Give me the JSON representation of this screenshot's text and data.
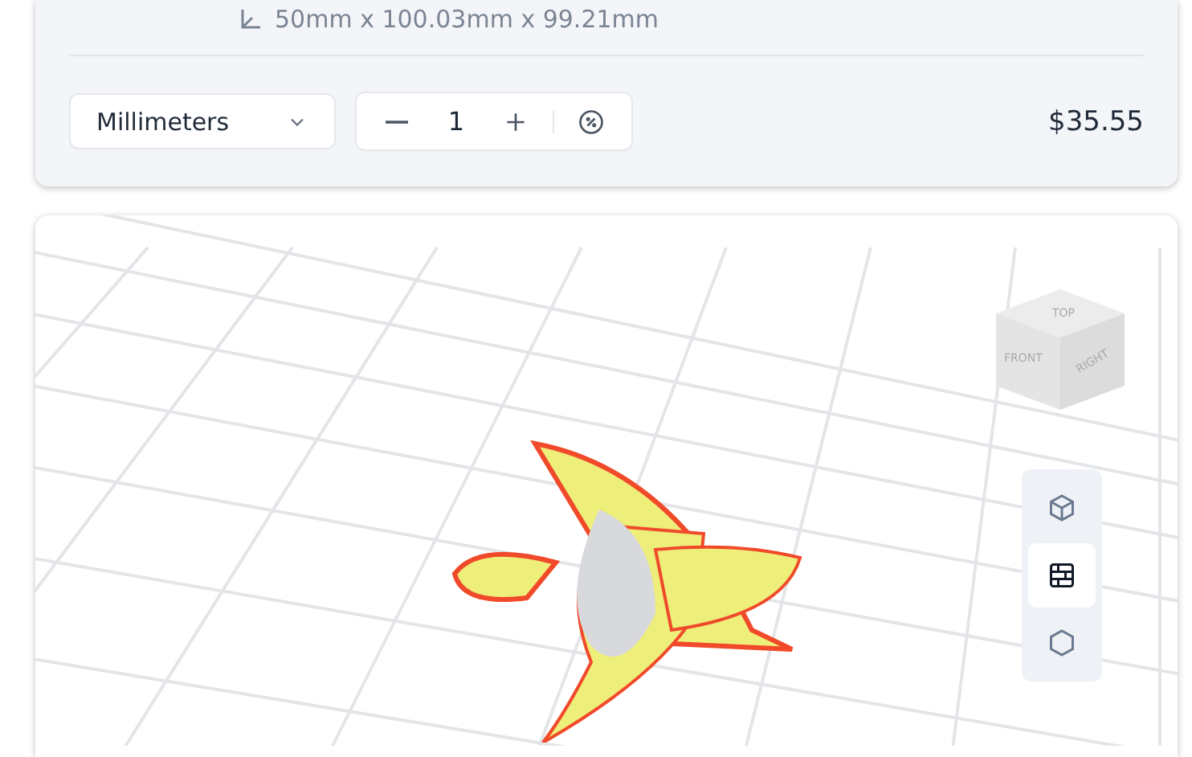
{
  "part_summary": {
    "dimensions": "50mm x 100.03mm x 99.21mm",
    "unit_select": {
      "value": "Millimeters"
    },
    "quantity": "1",
    "price": "$35.55"
  },
  "viewer": {
    "view_cube": {
      "faces": [
        "TOP",
        "FRONT",
        "RIGHT"
      ]
    },
    "view_modes": [
      {
        "kind": "solid",
        "selected": false
      },
      {
        "kind": "grid",
        "selected": true
      },
      {
        "kind": "outline",
        "selected": false
      }
    ]
  }
}
